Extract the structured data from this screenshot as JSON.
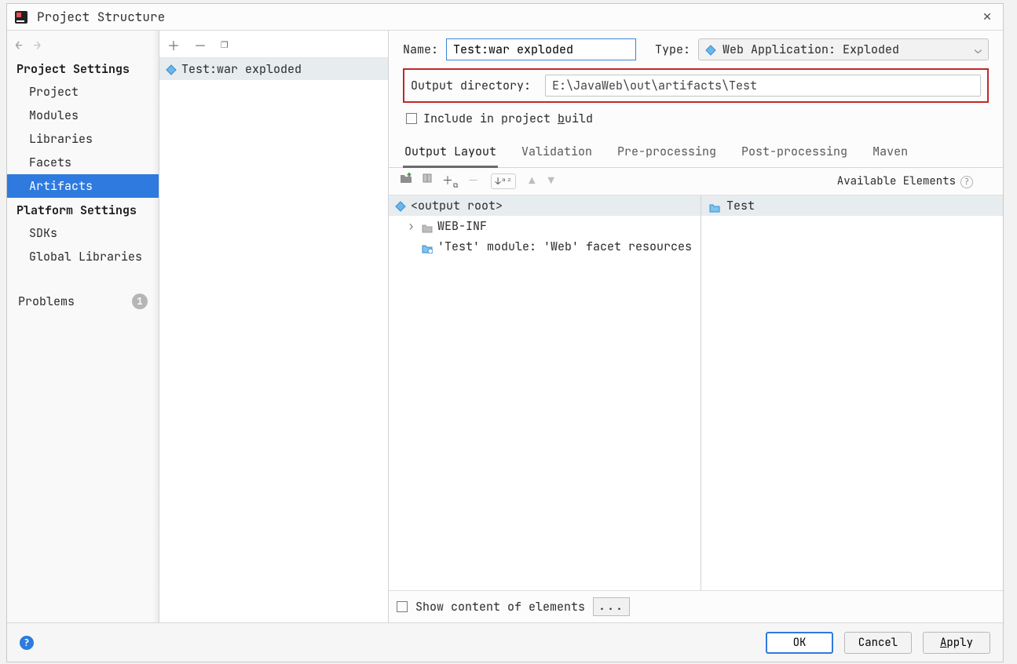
{
  "window": {
    "title": "Project Structure"
  },
  "sidebar": {
    "sections": [
      {
        "title": "Project Settings",
        "items": [
          {
            "label": "Project",
            "selected": false
          },
          {
            "label": "Modules",
            "selected": false
          },
          {
            "label": "Libraries",
            "selected": false
          },
          {
            "label": "Facets",
            "selected": false
          },
          {
            "label": "Artifacts",
            "selected": true
          }
        ]
      },
      {
        "title": "Platform Settings",
        "items": [
          {
            "label": "SDKs",
            "selected": false
          },
          {
            "label": "Global Libraries",
            "selected": false
          }
        ]
      }
    ],
    "problems": {
      "label": "Problems",
      "count": "1"
    }
  },
  "artifacts_list": {
    "items": [
      {
        "label": "Test:war exploded"
      }
    ]
  },
  "details": {
    "name_label": "Name:",
    "name_value": "Test:war exploded",
    "type_label": "Type:",
    "type_value": "Web Application: Exploded",
    "output_dir_label": "Output directory:",
    "output_dir_value": "E:\\JavaWeb\\out\\artifacts\\Test",
    "include_label": "Include in project build",
    "tabs": [
      "Output Layout",
      "Validation",
      "Pre-processing",
      "Post-processing",
      "Maven"
    ],
    "active_tab": 0,
    "available_elements_label": "Available Elements",
    "output_root_label": "<output root>",
    "tree": [
      {
        "label": "WEB-INF",
        "kind": "folder",
        "expandable": true
      },
      {
        "label": "'Test' module: 'Web' facet resources",
        "kind": "facet",
        "expandable": false
      }
    ],
    "available": [
      {
        "label": "Test",
        "kind": "module"
      }
    ],
    "show_content_label": "Show content of elements"
  },
  "footer": {
    "ok": "OK",
    "cancel": "Cancel",
    "apply": "Apply"
  }
}
